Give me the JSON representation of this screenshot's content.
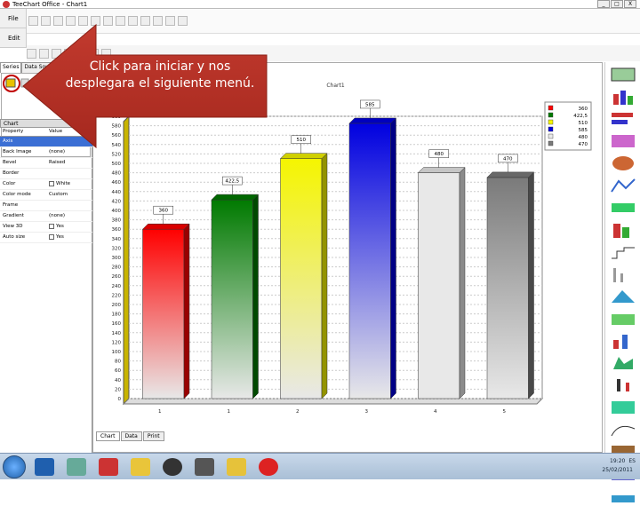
{
  "window": {
    "title": "TeeChart Office - Chart1",
    "buttons": [
      "_",
      "□",
      "X"
    ]
  },
  "menu": {
    "file": "File",
    "edit": "Edit"
  },
  "left_tabs": [
    "Series",
    "Data Source"
  ],
  "inspector": {
    "header": "Chart",
    "col_property": "Property",
    "col_value": "Value",
    "rows": [
      {
        "property": "Axis",
        "value": "",
        "selected": true
      },
      {
        "property": "Back Image",
        "value": "(none)"
      },
      {
        "property": "Bevel",
        "value": "Raised"
      },
      {
        "property": "Border",
        "value": ""
      },
      {
        "property": "Color",
        "value": "White",
        "swatch": "#ffffff"
      },
      {
        "property": "Color mode",
        "value": "Custom"
      },
      {
        "property": "Frame",
        "value": ""
      },
      {
        "property": "Gradient",
        "value": "(none)"
      },
      {
        "property": "View 3D",
        "value": "Yes",
        "check": true
      },
      {
        "property": "Auto size",
        "value": "Yes",
        "check": true
      }
    ]
  },
  "bottom_tabs": [
    "Chart",
    "Data",
    "Print"
  ],
  "callout_text": "Click para iniciar y nos desplegara el siguiente menú.",
  "chart_data": {
    "type": "bar",
    "title": "Chart1",
    "categories": [
      "1",
      "1",
      "2",
      "3",
      "4",
      "5"
    ],
    "values": [
      360,
      422.5,
      510,
      585,
      480,
      470
    ],
    "data_labels": [
      "360",
      "422,5",
      "510",
      "585",
      "480",
      "470"
    ],
    "colors": [
      "#ff0000",
      "#007a00",
      "#f5f500",
      "#0000e0",
      "#e8e8e8",
      "#7a7a7a"
    ],
    "ylim": [
      0,
      600
    ],
    "ytick_step": 20,
    "legend": {
      "position": "top-right",
      "entries": [
        "360",
        "422,5",
        "510",
        "585",
        "480",
        "470"
      ]
    },
    "grid": true
  },
  "taskbar": {
    "time": "19:20",
    "date": "25/02/2011",
    "lang": "ES"
  }
}
